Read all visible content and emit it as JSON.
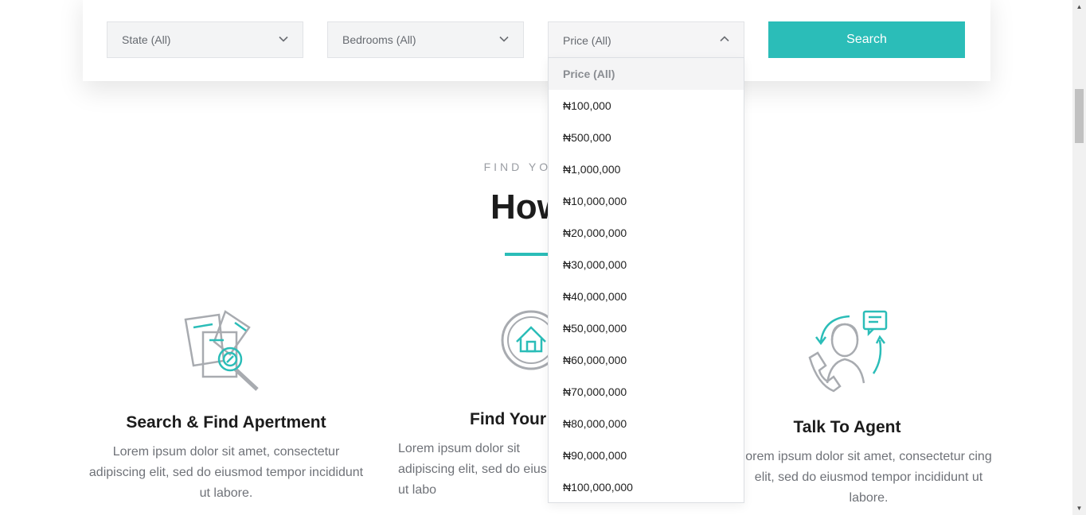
{
  "search": {
    "state_placeholder": "State (All)",
    "bedrooms_placeholder": "Bedrooms (All)",
    "price_value": "Price (All)",
    "search_label": "Search"
  },
  "dropdown": {
    "options": [
      "Price (All)",
      "₦100,000",
      "₦500,000",
      "₦1,000,000",
      "₦10,000,000",
      "₦20,000,000",
      "₦30,000,000",
      "₦40,000,000",
      "₦50,000,000",
      "₦60,000,000",
      "₦70,000,000",
      "₦80,000,000",
      "₦90,000,000",
      "₦100,000,000"
    ]
  },
  "section": {
    "eyebrow": "FIND YOUR DR",
    "title": "How It"
  },
  "features": [
    {
      "icon": "document-search-icon",
      "title": "Search & Find Apertment",
      "text": "Lorem ipsum dolor sit amet, consectetur adipiscing elit, sed do eiusmod tempor incididunt ut labore."
    },
    {
      "icon": "house-circle-icon",
      "title": "Find Your",
      "text": "Lorem ipsum dolor sit adipiscing elit, sed do eius ut labo"
    },
    {
      "icon": "agent-headset-icon",
      "title": "Talk To Agent",
      "text": "orem ipsum dolor sit amet, consectetur cing elit, sed do eiusmod tempor incididunt ut labore."
    }
  ],
  "colors": {
    "accent": "#2bbdb8",
    "icon_gray": "#a8abb0"
  }
}
